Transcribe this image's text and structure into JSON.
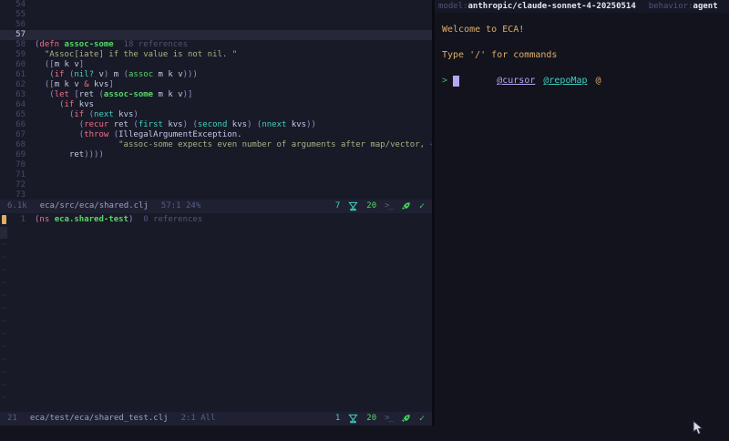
{
  "palette": {
    "bgLeft": "#191a27",
    "bgRight": "#12131d",
    "bgStatus": "#1f2132",
    "winbarBg": "#171825",
    "cursorline": "#262839",
    "fg": "#c3cae6",
    "dim": "#565f89",
    "linenr": "#444a68",
    "linenrCur": "#c9cee8",
    "kw": "#f0708b",
    "fn": "#55d667",
    "teal": "#41cfc2",
    "green": "#55d667",
    "str": "#a9b285",
    "par": "#998ccc",
    "lens": "#4e5578",
    "orange": "#dfae67",
    "purple": "#b7a6f4",
    "tilde": "#2e3250",
    "statusPath": "#9aa1c4",
    "checkGreen": "#43d15b",
    "promptGreen": "#4faf6a",
    "winbarValue": "#e3e7f6"
  },
  "left": {
    "win1": {
      "lines": [
        {
          "n": "54"
        },
        {
          "n": "55"
        },
        {
          "n": "56"
        },
        {
          "n": "57",
          "cur": true
        },
        {
          "n": "58",
          "t": [
            [
              "(",
              "par"
            ],
            [
              "defn",
              "kw"
            ],
            [
              " ",
              ""
            ],
            [
              "assoc-some",
              "fn"
            ],
            [
              "  18 references",
              "lens"
            ]
          ]
        },
        {
          "n": "59",
          "t": [
            [
              "  \"Assoc[iate] if the value is not nil. \"",
              "str"
            ]
          ]
        },
        {
          "n": "60",
          "t": [
            [
              "  ",
              ""
            ],
            [
              "([",
              "par"
            ],
            [
              "m k v",
              ""
            ],
            [
              "]",
              "par"
            ]
          ]
        },
        {
          "n": "61",
          "t": [
            [
              "   ",
              ""
            ],
            [
              "(",
              "par"
            ],
            [
              "if",
              "kw"
            ],
            [
              " ",
              ""
            ],
            [
              "(",
              "par"
            ],
            [
              "nil?",
              "teal"
            ],
            [
              " v",
              ""
            ],
            [
              ")",
              "par"
            ],
            [
              " m ",
              ""
            ],
            [
              "(",
              "par"
            ],
            [
              "assoc",
              "green"
            ],
            [
              " m k v",
              ""
            ],
            [
              ")))",
              "par"
            ]
          ]
        },
        {
          "n": "62",
          "t": [
            [
              "  ",
              ""
            ],
            [
              "([",
              "par"
            ],
            [
              "m k v ",
              ""
            ],
            [
              "&",
              "kw"
            ],
            [
              " kvs",
              ""
            ],
            [
              "]",
              "par"
            ]
          ]
        },
        {
          "n": "63",
          "t": [
            [
              "   ",
              ""
            ],
            [
              "(",
              "par"
            ],
            [
              "let",
              "kw"
            ],
            [
              " ",
              ""
            ],
            [
              "[",
              "par"
            ],
            [
              "ret ",
              ""
            ],
            [
              "(",
              "par"
            ],
            [
              "assoc-some",
              "fn"
            ],
            [
              " m k v",
              ""
            ],
            [
              ")]",
              "par"
            ]
          ]
        },
        {
          "n": "64",
          "t": [
            [
              "     ",
              ""
            ],
            [
              "(",
              "par"
            ],
            [
              "if",
              "kw"
            ],
            [
              " kvs",
              ""
            ]
          ]
        },
        {
          "n": "65",
          "t": [
            [
              "       ",
              ""
            ],
            [
              "(",
              "par"
            ],
            [
              "if",
              "kw"
            ],
            [
              " ",
              ""
            ],
            [
              "(",
              "par"
            ],
            [
              "next",
              "teal"
            ],
            [
              " kvs",
              ""
            ],
            [
              ")",
              "par"
            ]
          ]
        },
        {
          "n": "66",
          "t": [
            [
              "         ",
              ""
            ],
            [
              "(",
              "par"
            ],
            [
              "recur",
              "kw"
            ],
            [
              " ret ",
              ""
            ],
            [
              "(",
              "par"
            ],
            [
              "first",
              "teal"
            ],
            [
              " kvs",
              ""
            ],
            [
              ")",
              "par"
            ],
            [
              " ",
              ""
            ],
            [
              "(",
              "par"
            ],
            [
              "second",
              "teal"
            ],
            [
              " kvs",
              ""
            ],
            [
              ")",
              "par"
            ],
            [
              " ",
              ""
            ],
            [
              "(",
              "par"
            ],
            [
              "nnext",
              "teal"
            ],
            [
              " kvs",
              ""
            ],
            [
              "))",
              "par"
            ]
          ]
        },
        {
          "n": "67",
          "t": [
            [
              "         ",
              ""
            ],
            [
              "(",
              "par"
            ],
            [
              "throw",
              "kw"
            ],
            [
              " ",
              ""
            ],
            [
              "(",
              "par"
            ],
            [
              "IllegalArgumentException.",
              ""
            ]
          ]
        },
        {
          "n": "68",
          "t": [
            [
              "                 \"assoc-some expects even number of arguments after map/vector, ",
              "str"
            ],
            [
              "+",
              "lens"
            ]
          ]
        },
        {
          "n": "69",
          "t": [
            [
              "       ",
              ""
            ],
            [
              "ret",
              ""
            ],
            [
              "))))",
              "par"
            ]
          ]
        },
        {
          "n": "70"
        },
        {
          "n": "71"
        },
        {
          "n": "72"
        },
        {
          "n": "73"
        }
      ]
    },
    "status1": {
      "size": "6.1k",
      "path": "eca/src/eca/shared.clj",
      "position": "57:1 24%",
      "repl_count": "7",
      "jobs_count": "20",
      "terminal_icon": ">_",
      "check_icon": "✓"
    },
    "win2": {
      "lines": [
        {
          "n": "1",
          "sign": true,
          "t": [
            [
              "(",
              "par"
            ],
            [
              "ns",
              "kw"
            ],
            [
              " ",
              ""
            ],
            [
              "eca.shared-test",
              "fn"
            ],
            [
              ")",
              "par"
            ],
            [
              "  0 references",
              "lens"
            ]
          ]
        }
      ],
      "fill": {
        "char": "~",
        "count": 14
      }
    },
    "status2": {
      "size": "21",
      "path": "eca/test/eca/shared_test.clj",
      "position": "2:1 All",
      "repl_count": "1",
      "jobs_count": "20",
      "terminal_icon": ">_",
      "check_icon": "✓"
    }
  },
  "chat": {
    "winbar": {
      "model_label": "model:",
      "model_value": "anthropic/claude-sonnet-4-20250514",
      "behavior_label": "behavior:",
      "behavior_value": "agent"
    },
    "welcome": "Welcome to ECA!",
    "hint": "Type '/' for commands",
    "mentions": [
      {
        "text": "@cursor"
      },
      {
        "text": "@repoMap"
      },
      {
        "text": "@"
      }
    ],
    "prompt": ">"
  }
}
